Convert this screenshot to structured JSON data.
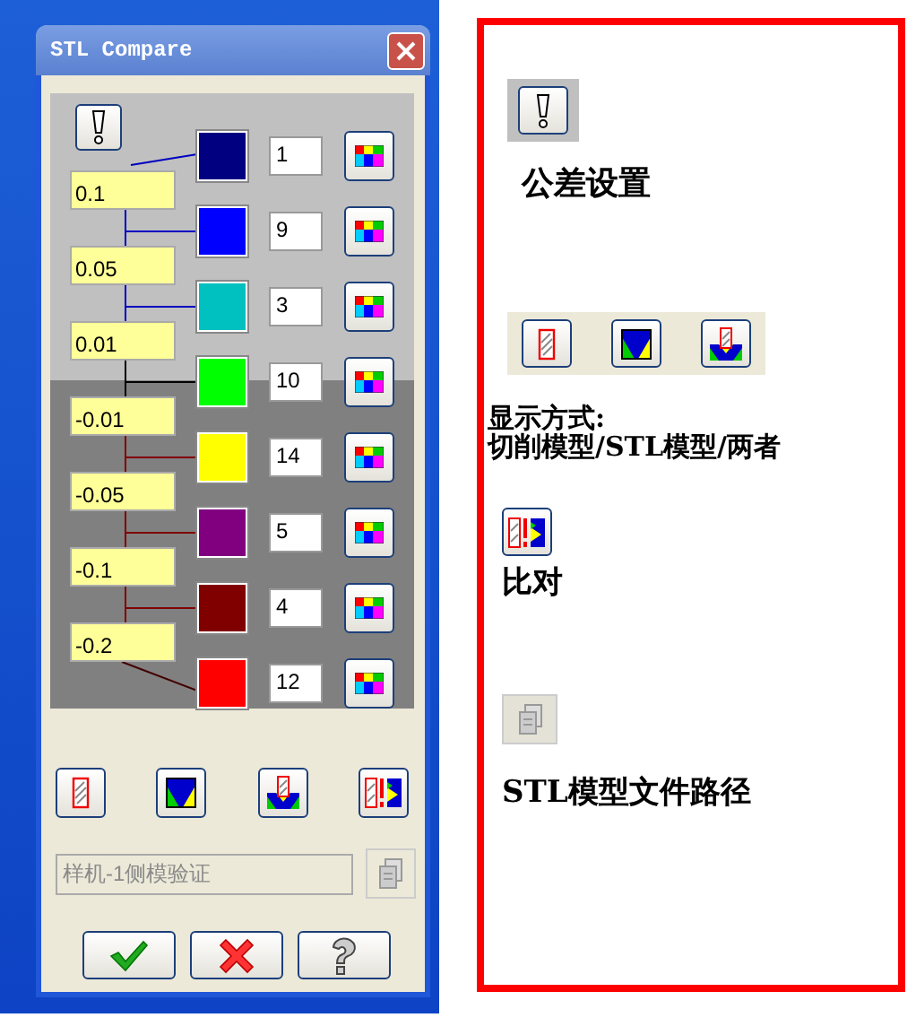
{
  "dialog": {
    "title": "STL Compare",
    "tolerances": [
      {
        "value": "0.1"
      },
      {
        "value": "0.05"
      },
      {
        "value": "0.01"
      },
      {
        "value": "-0.01"
      },
      {
        "value": "-0.05"
      },
      {
        "value": "-0.1"
      },
      {
        "value": "-0.2"
      }
    ],
    "bands": [
      {
        "color": "#000080",
        "count": "1"
      },
      {
        "color": "#0000ff",
        "count": "9"
      },
      {
        "color": "#00c0c0",
        "count": "3"
      },
      {
        "color": "#00ff00",
        "count": "10"
      },
      {
        "color": "#ffff00",
        "count": "14"
      },
      {
        "color": "#800080",
        "count": "5"
      },
      {
        "color": "#800000",
        "count": "4"
      },
      {
        "color": "#ff0000",
        "count": "12"
      }
    ],
    "file_path": {
      "value": "样机-1侧模验证",
      "disabled": true
    }
  },
  "annotation": {
    "items": [
      {
        "kind": "tolerance",
        "lines": [
          "公差设置"
        ]
      },
      {
        "kind": "display",
        "lines": [
          "显示方式:",
          "切削模型/STL模型/两者"
        ]
      },
      {
        "kind": "compare",
        "lines": [
          "比对"
        ]
      },
      {
        "kind": "browse",
        "lines": [
          "STL模型文件路径"
        ]
      }
    ]
  }
}
